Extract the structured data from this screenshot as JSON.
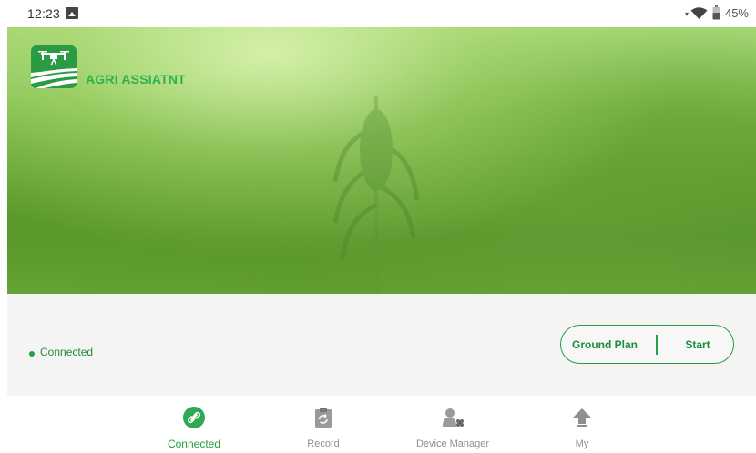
{
  "status_bar": {
    "time": "12:23",
    "battery": "45%",
    "icons": [
      "image-icon",
      "data-arrows-icon",
      "wifi-icon",
      "battery-icon"
    ]
  },
  "hero": {
    "brand": "AGRI ASSIATNT",
    "logo_icon": "drone-field-logo"
  },
  "connection": {
    "status": "Connected",
    "status_color": "#22a244"
  },
  "actions": {
    "ground_plan": "Ground Plan",
    "start": "Start"
  },
  "bottom_nav": {
    "items": [
      {
        "label": "Connected",
        "icon": "link-icon",
        "active": true
      },
      {
        "label": "Record",
        "icon": "clipboard-icon",
        "active": false
      },
      {
        "label": "Device Manager",
        "icon": "user-drone-icon",
        "active": false
      },
      {
        "label": "My",
        "icon": "upload-icon",
        "active": false
      }
    ]
  },
  "colors": {
    "accent": "#1f9f3e",
    "muted": "#8f8f8f",
    "panel": "#f4f4f4"
  }
}
